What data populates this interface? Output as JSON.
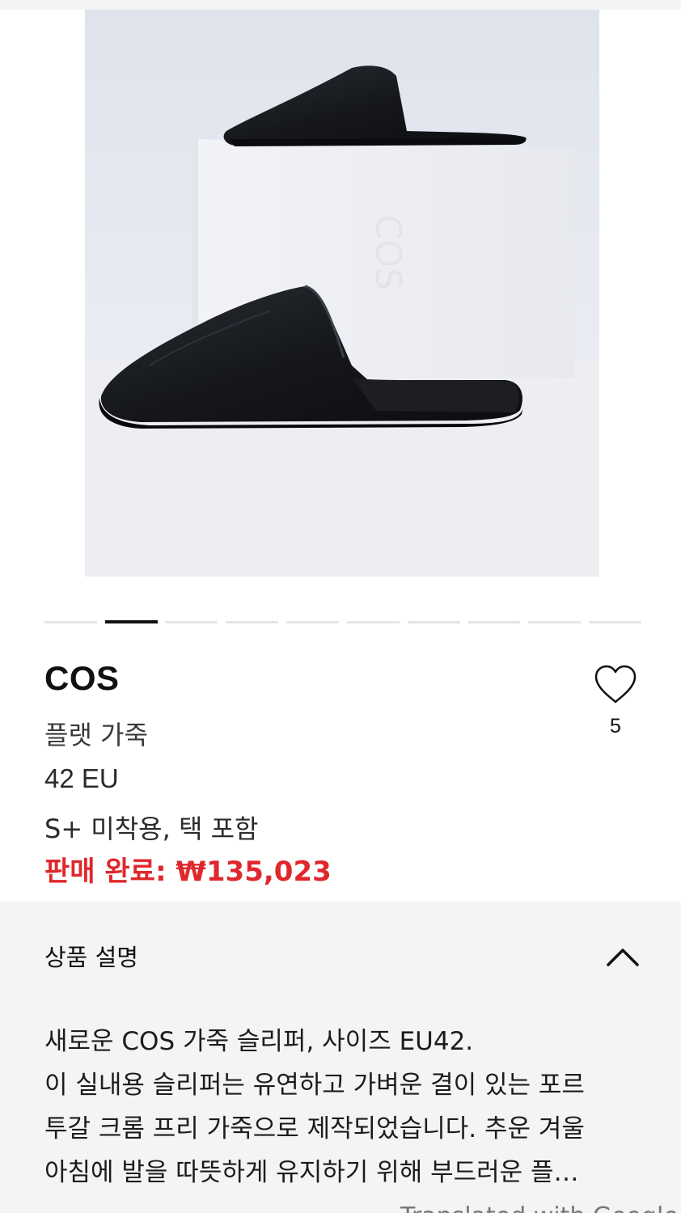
{
  "product": {
    "image_alt": "COS leather slippers",
    "brand": "COS",
    "category": "플랫 가죽",
    "size": "42 EU",
    "condition": "S+ 미착용, 택 포함",
    "price_status": "판매 완료: ₩135,023",
    "likes": "5"
  },
  "carousel": {
    "total": 10,
    "active_index": 1
  },
  "description": {
    "header": "상품 설명",
    "lines": [
      "새로운 COS 가죽 슬리퍼, 사이즈 EU42.",
      "이 실내용 슬리퍼는 유연하고 가벼운 결이 있는 포르",
      "투갈 크롬 프리 가죽으로 제작되었습니다. 추운 겨울",
      "아침에 발을 따뜻하게 유지하기 위해 부드러운 플…"
    ],
    "translated_note": "Translated with Google"
  },
  "colors": {
    "price_red": "#e0272b",
    "panel_bg": "#f4f4f4",
    "active_dot": "#111111"
  },
  "icons": {
    "like": "heart-outline-icon",
    "collapse": "chevron-up-icon"
  }
}
